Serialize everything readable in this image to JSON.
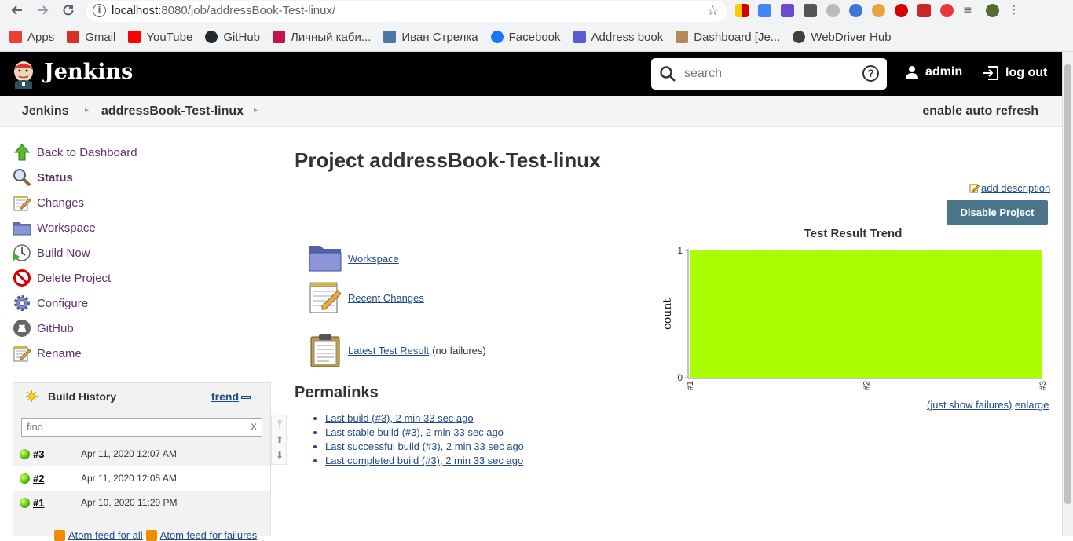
{
  "browser": {
    "url_host": "localhost",
    "url_path": ":8080/job/addressBook-Test-linux/",
    "bookmarks": [
      {
        "label": "Apps",
        "icon": "apps-grid-icon",
        "color": "#e94235"
      },
      {
        "label": "Gmail",
        "icon": "gmail-icon",
        "color": "#d93025"
      },
      {
        "label": "YouTube",
        "icon": "youtube-icon",
        "color": "#ff0000"
      },
      {
        "label": "GitHub",
        "icon": "github-icon",
        "color": "#24292e"
      },
      {
        "label": "Личный каби...",
        "icon": "profile-icon",
        "color": "#c5124f"
      },
      {
        "label": "Иван Стрелка",
        "icon": "vk-icon",
        "color": "#4a76a8"
      },
      {
        "label": "Facebook",
        "icon": "facebook-icon",
        "color": "#1877f2"
      },
      {
        "label": "Address book",
        "icon": "address-book-icon",
        "color": "#5b5bd6"
      },
      {
        "label": "Dashboard [Je...",
        "icon": "jenkins-icon",
        "color": "#b58a59"
      },
      {
        "label": "WebDriver Hub",
        "icon": "globe-icon",
        "color": "#3c4043"
      }
    ]
  },
  "header": {
    "title": "Jenkins",
    "search_placeholder": "search",
    "help": "?",
    "user": "admin",
    "logout": "log out"
  },
  "breadcrumb": {
    "root": "Jenkins",
    "job": "addressBook-Test-linux",
    "auto_refresh": "enable auto refresh"
  },
  "sidebar": {
    "tasks": [
      {
        "label": "Back to Dashboard",
        "icon": "up-arrow-icon",
        "bold": false
      },
      {
        "label": "Status",
        "icon": "search-magnifier-icon",
        "bold": true
      },
      {
        "label": "Changes",
        "icon": "notepad-icon",
        "bold": false
      },
      {
        "label": "Workspace",
        "icon": "folder-icon",
        "bold": false
      },
      {
        "label": "Build Now",
        "icon": "clock-play-icon",
        "bold": false
      },
      {
        "label": "Delete Project",
        "icon": "no-entry-icon",
        "bold": false
      },
      {
        "label": "Configure",
        "icon": "gear-icon",
        "bold": false
      },
      {
        "label": "GitHub",
        "icon": "github-icon",
        "bold": false
      },
      {
        "label": "Rename",
        "icon": "notepad-icon",
        "bold": false
      }
    ]
  },
  "build_history": {
    "title": "Build History",
    "trend": "trend",
    "find_placeholder": "find",
    "clear": "x",
    "builds": [
      {
        "number": "#3",
        "date": "Apr 11, 2020 12:07 AM",
        "status": "success"
      },
      {
        "number": "#2",
        "date": "Apr 11, 2020 12:05 AM",
        "status": "success"
      },
      {
        "number": "#1",
        "date": "Apr 10, 2020 11:29 PM",
        "status": "success"
      }
    ],
    "feed_all": "Atom feed for all",
    "feed_failures": "Atom feed for failures"
  },
  "main": {
    "title": "Project addressBook-Test-linux",
    "add_description": "add description",
    "disable_button": "Disable Project",
    "links": [
      {
        "label": "Workspace",
        "icon": "folder-icon",
        "extra": ""
      },
      {
        "label": "Recent Changes",
        "icon": "notepad-icon",
        "extra": ""
      },
      {
        "label": "Latest Test Result",
        "icon": "clipboard-icon",
        "extra": "(no failures)"
      }
    ],
    "permalinks_title": "Permalinks",
    "permalinks": [
      "Last build (#3), 2 min 33 sec ago",
      "Last stable build (#3), 2 min 33 sec ago",
      "Last successful build (#3), 2 min 33 sec ago",
      "Last completed build (#3), 2 min 33 sec ago"
    ],
    "just_show_failures": "(just show failures)",
    "enlarge": "enlarge"
  },
  "chart_data": {
    "type": "area",
    "title": "Test Result Trend",
    "xlabel": "",
    "ylabel": "count",
    "categories": [
      "#1",
      "#2",
      "#3"
    ],
    "series": [
      {
        "name": "",
        "values": [
          1,
          1,
          1
        ],
        "color": "#a9ff00"
      }
    ],
    "ylim": [
      0,
      1
    ],
    "yticks": [
      "0",
      "1"
    ],
    "grid": true
  },
  "colors": {
    "header_bg": "#000000",
    "link": "#204a87",
    "task_link": "#5c3566",
    "button_bg": "#4b758b",
    "pass_area": "#a9ff00"
  }
}
